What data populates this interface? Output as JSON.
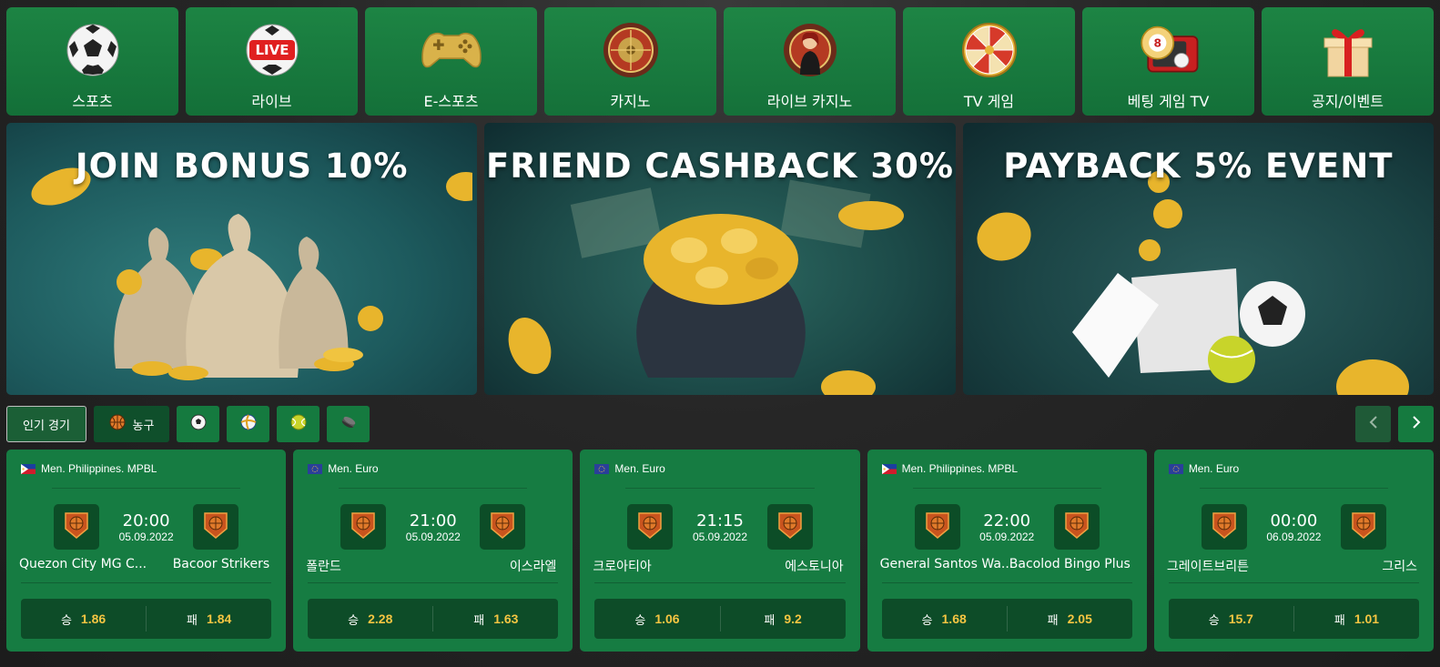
{
  "categories": [
    {
      "label": "스포츠",
      "icon": "soccer-ball-icon"
    },
    {
      "label": "라이브",
      "icon": "live-ball-icon"
    },
    {
      "label": "E-스포츠",
      "icon": "gamepad-icon"
    },
    {
      "label": "카지노",
      "icon": "roulette-icon"
    },
    {
      "label": "라이브 카지노",
      "icon": "live-dealer-icon"
    },
    {
      "label": "TV 게임",
      "icon": "wheel-of-fortune-icon"
    },
    {
      "label": "베팅 게임 TV",
      "icon": "lottery-tv-icon"
    },
    {
      "label": "공지/이벤트",
      "icon": "gift-box-icon"
    }
  ],
  "live_badge": "LIVE",
  "tv_badge": "8",
  "banners": [
    {
      "title": "JOIN BONUS 10%"
    },
    {
      "title": "FRIEND CASHBACK 30%"
    },
    {
      "title": "PAYBACK 5% EVENT"
    }
  ],
  "filters": {
    "popular_label": "인기 경기",
    "basketball_label": "농구",
    "sports": [
      "soccer-icon",
      "volleyball-icon",
      "tennis-icon",
      "hockey-puck-icon"
    ]
  },
  "matches": [
    {
      "league": "Men. Philippines. MPBL",
      "flag": "philippines-flag",
      "time": "20:00",
      "date": "05.09.2022",
      "home": "Quezon City MG C...",
      "away": "Bacoor Strikers",
      "win_label": "승",
      "win": "1.86",
      "lose_label": "패",
      "lose": "1.84"
    },
    {
      "league": "Men. Euro",
      "flag": "eu-flag",
      "time": "21:00",
      "date": "05.09.2022",
      "home": "폴란드",
      "away": "이스라엘",
      "win_label": "승",
      "win": "2.28",
      "lose_label": "패",
      "lose": "1.63"
    },
    {
      "league": "Men. Euro",
      "flag": "eu-flag",
      "time": "21:15",
      "date": "05.09.2022",
      "home": "크로아티아",
      "away": "에스토니아",
      "win_label": "승",
      "win": "1.06",
      "lose_label": "패",
      "lose": "9.2"
    },
    {
      "league": "Men. Philippines. MPBL",
      "flag": "philippines-flag",
      "time": "22:00",
      "date": "05.09.2022",
      "home": "General Santos Wa...",
      "away": "Bacolod Bingo Plus",
      "win_label": "승",
      "win": "1.68",
      "lose_label": "패",
      "lose": "2.05"
    },
    {
      "league": "Men. Euro",
      "flag": "eu-flag",
      "time": "00:00",
      "date": "06.09.2022",
      "home": "그레이트브리튼",
      "away": "그리스",
      "win_label": "승",
      "win": "15.7",
      "lose_label": "패",
      "lose": "1.01"
    }
  ],
  "colors": {
    "accent": "#167c42",
    "odds": "#f5c542",
    "dark_green": "#0d4c28"
  }
}
